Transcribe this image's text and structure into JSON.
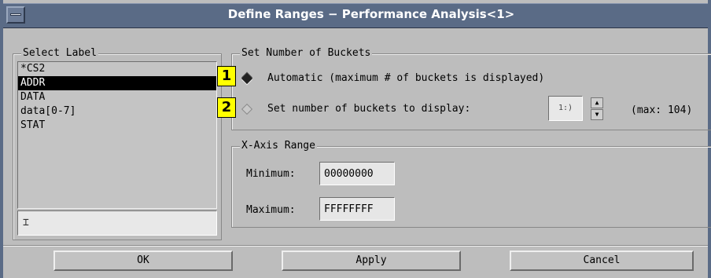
{
  "window": {
    "title": "Define Ranges − Performance Analysis<1>"
  },
  "select_label": {
    "legend": "Select Label",
    "items": [
      {
        "label": "*CS2",
        "selected": false
      },
      {
        "label": "ADDR",
        "selected": true
      },
      {
        "label": "DATA",
        "selected": false
      },
      {
        "label": "data[0-7]",
        "selected": false
      },
      {
        "label": "STAT",
        "selected": false
      }
    ],
    "input_value": ""
  },
  "buckets": {
    "legend": "Set Number of Buckets",
    "badge_1": "1",
    "badge_2": "2",
    "option_automatic": "Automatic (maximum # of buckets is displayed)",
    "option_set": "Set number of buckets to display:",
    "count_value": "1:)",
    "max_label": "(max: 104)",
    "selected_option": "automatic"
  },
  "x_axis": {
    "legend": "X-Axis Range",
    "minimum_label": "Minimum:",
    "minimum_value": "00000000",
    "maximum_label": "Maximum:",
    "maximum_value": "FFFFFFFF"
  },
  "buttons": {
    "ok": "OK",
    "apply": "Apply",
    "cancel": "Cancel"
  },
  "colors": {
    "titlebar": "#5a6b86",
    "background": "#bdbdbd",
    "badge": "#ffff00",
    "selection": "#000000"
  }
}
